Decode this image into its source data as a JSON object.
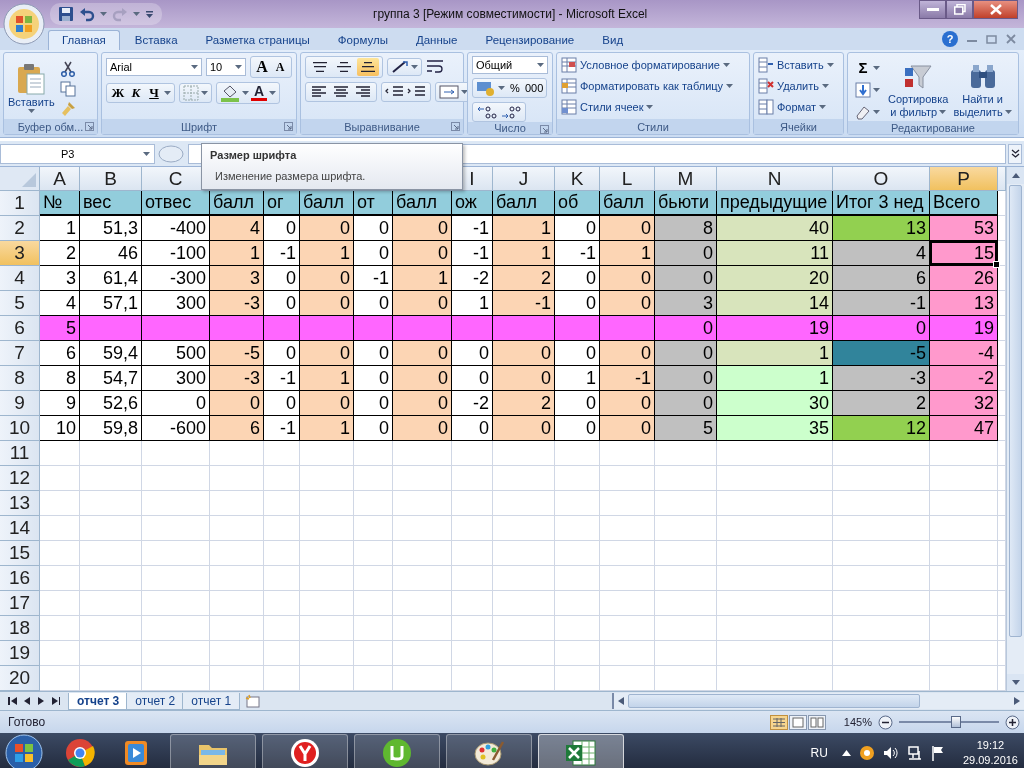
{
  "window": {
    "title": "группа 3  [Режим совместимости] - Microsoft Excel"
  },
  "ribbon_tabs": [
    {
      "label": "Главная",
      "selected": true
    },
    {
      "label": "Вставка",
      "selected": false
    },
    {
      "label": "Разметка страницы",
      "selected": false
    },
    {
      "label": "Формулы",
      "selected": false
    },
    {
      "label": "Данные",
      "selected": false
    },
    {
      "label": "Рецензирование",
      "selected": false
    },
    {
      "label": "Вид",
      "selected": false
    }
  ],
  "help": "?",
  "clipboard": {
    "label": "Буфер обм...",
    "paste": "Вставить"
  },
  "font": {
    "label": "Шрифт",
    "font_name": "Arial",
    "font_size": "10",
    "grow": "A",
    "shrink": "A",
    "bold": "Ж",
    "italic": "К",
    "underline": "Ч",
    "color_button": "A"
  },
  "alignment": {
    "label": "Выравнивание",
    "vertical": [
      {
        "selected": false
      },
      {
        "selected": false
      },
      {
        "selected": true
      }
    ]
  },
  "number": {
    "label": "Число",
    "format": "Общий",
    "percent": "%",
    "thousands": "000"
  },
  "styles": {
    "label": "Стили",
    "items": [
      "Условное форматирование",
      "Форматировать как таблицу",
      "Стили ячеек"
    ]
  },
  "cells": {
    "label": "Ячейки",
    "items": [
      "Вставить",
      "Удалить",
      "Формат"
    ]
  },
  "editing": {
    "label": "Редактирование",
    "sum": "Σ",
    "sort": [
      "Сортировка",
      "и фильтр"
    ],
    "find": [
      "Найти и",
      "выделить"
    ]
  },
  "formula_bar": {
    "name_box": "P3"
  },
  "tooltip": {
    "title": "Размер шрифта",
    "text": "Изменение размера шрифта."
  },
  "column_headers": [
    {
      "letter": "A",
      "selected": false
    },
    {
      "letter": "B",
      "selected": false
    },
    {
      "letter": "C",
      "selected": false
    },
    {
      "letter": "I",
      "selected": false
    },
    {
      "letter": "J",
      "selected": false
    },
    {
      "letter": "K",
      "selected": false
    },
    {
      "letter": "L",
      "selected": false
    },
    {
      "letter": "M",
      "selected": false
    },
    {
      "letter": "N",
      "selected": false
    },
    {
      "letter": "O",
      "selected": false
    },
    {
      "letter": "P",
      "selected": true
    }
  ],
  "rows": [
    {
      "header": "1",
      "selected": false,
      "cells": [
        {
          "value": "№",
          "color": "#92cddc",
          "selected": false
        },
        {
          "value": "вес",
          "color": "#92cddc",
          "selected": false
        },
        {
          "value": "отвес",
          "color": "#92cddc",
          "selected": false
        },
        {
          "value": "балл",
          "color": "#92cddc",
          "selected": false
        },
        {
          "value": "ог",
          "color": "#92cddc",
          "selected": false
        },
        {
          "value": "балл",
          "color": "#92cddc",
          "selected": false
        },
        {
          "value": "от",
          "color": "#92cddc",
          "selected": false
        },
        {
          "value": "балл",
          "color": "#92cddc",
          "selected": false
        },
        {
          "value": "ож",
          "color": "#92cddc",
          "selected": false
        },
        {
          "value": "балл",
          "color": "#92cddc",
          "selected": false
        },
        {
          "value": "об",
          "color": "#92cddc",
          "selected": false
        },
        {
          "value": "балл",
          "color": "#92cddc",
          "selected": false
        },
        {
          "value": "бьюти",
          "color": "#92cddc",
          "selected": false
        },
        {
          "value": "предыдущие",
          "color": "#92cddc",
          "selected": false
        },
        {
          "value": "Итог 3 нед",
          "color": "#92cddc",
          "selected": false
        },
        {
          "value": "Всего",
          "color": "#92cddc",
          "selected": false
        }
      ]
    },
    {
      "header": "2",
      "selected": false,
      "cells": [
        {
          "value": "1",
          "color": "#ffffff",
          "selected": false
        },
        {
          "value": "51,3",
          "color": "#ffffff",
          "selected": false
        },
        {
          "value": "-400",
          "color": "#ffffff",
          "selected": false
        },
        {
          "value": "4",
          "color": "#fcd5b4",
          "selected": false
        },
        {
          "value": "0",
          "color": "#ffffff",
          "selected": false
        },
        {
          "value": "0",
          "color": "#fcd5b4",
          "selected": false
        },
        {
          "value": "0",
          "color": "#ffffff",
          "selected": false
        },
        {
          "value": "0",
          "color": "#fcd5b4",
          "selected": false
        },
        {
          "value": "-1",
          "color": "#ffffff",
          "selected": false
        },
        {
          "value": "1",
          "color": "#fcd5b4",
          "selected": false
        },
        {
          "value": "0",
          "color": "#ffffff",
          "selected": false
        },
        {
          "value": "0",
          "color": "#fcd5b4",
          "selected": false
        },
        {
          "value": "8",
          "color": "#c0c0c0",
          "selected": false
        },
        {
          "value": "40",
          "color": "#d8e4bc",
          "selected": false
        },
        {
          "value": "13",
          "color": "#92d050",
          "selected": false
        },
        {
          "value": "53",
          "color": "#ff99cc",
          "selected": false
        }
      ]
    },
    {
      "header": "3",
      "selected": true,
      "cells": [
        {
          "value": "2",
          "color": "#ffffff",
          "selected": false
        },
        {
          "value": "46",
          "color": "#ffffff",
          "selected": false
        },
        {
          "value": "-100",
          "color": "#ffffff",
          "selected": false
        },
        {
          "value": "1",
          "color": "#fcd5b4",
          "selected": false
        },
        {
          "value": "-1",
          "color": "#ffffff",
          "selected": false
        },
        {
          "value": "1",
          "color": "#fcd5b4",
          "selected": false
        },
        {
          "value": "0",
          "color": "#ffffff",
          "selected": false
        },
        {
          "value": "0",
          "color": "#fcd5b4",
          "selected": false
        },
        {
          "value": "-1",
          "color": "#ffffff",
          "selected": false
        },
        {
          "value": "1",
          "color": "#fcd5b4",
          "selected": false
        },
        {
          "value": "-1",
          "color": "#ffffff",
          "selected": false
        },
        {
          "value": "1",
          "color": "#fcd5b4",
          "selected": false
        },
        {
          "value": "0",
          "color": "#c0c0c0",
          "selected": false
        },
        {
          "value": "11",
          "color": "#d8e4bc",
          "selected": false
        },
        {
          "value": "4",
          "color": "#c0c0c0",
          "selected": false
        },
        {
          "value": "15",
          "color": "#ff99cc",
          "selected": true
        }
      ]
    },
    {
      "header": "4",
      "selected": false,
      "cells": [
        {
          "value": "3",
          "color": "#ffffff",
          "selected": false
        },
        {
          "value": "61,4",
          "color": "#ffffff",
          "selected": false
        },
        {
          "value": "-300",
          "color": "#ffffff",
          "selected": false
        },
        {
          "value": "3",
          "color": "#fcd5b4",
          "selected": false
        },
        {
          "value": "0",
          "color": "#ffffff",
          "selected": false
        },
        {
          "value": "0",
          "color": "#fcd5b4",
          "selected": false
        },
        {
          "value": "-1",
          "color": "#ffffff",
          "selected": false
        },
        {
          "value": "1",
          "color": "#fcd5b4",
          "selected": false
        },
        {
          "value": "-2",
          "color": "#ffffff",
          "selected": false
        },
        {
          "value": "2",
          "color": "#fcd5b4",
          "selected": false
        },
        {
          "value": "0",
          "color": "#ffffff",
          "selected": false
        },
        {
          "value": "0",
          "color": "#fcd5b4",
          "selected": false
        },
        {
          "value": "0",
          "color": "#c0c0c0",
          "selected": false
        },
        {
          "value": "20",
          "color": "#d8e4bc",
          "selected": false
        },
        {
          "value": "6",
          "color": "#c0c0c0",
          "selected": false
        },
        {
          "value": "26",
          "color": "#ff99cc",
          "selected": false
        }
      ]
    },
    {
      "header": "5",
      "selected": false,
      "cells": [
        {
          "value": "4",
          "color": "#ffffff",
          "selected": false
        },
        {
          "value": "57,1",
          "color": "#ffffff",
          "selected": false
        },
        {
          "value": "300",
          "color": "#ffffff",
          "selected": false
        },
        {
          "value": "-3",
          "color": "#fcd5b4",
          "selected": false
        },
        {
          "value": "0",
          "color": "#ffffff",
          "selected": false
        },
        {
          "value": "0",
          "color": "#fcd5b4",
          "selected": false
        },
        {
          "value": "0",
          "color": "#ffffff",
          "selected": false
        },
        {
          "value": "0",
          "color": "#fcd5b4",
          "selected": false
        },
        {
          "value": "1",
          "color": "#ffffff",
          "selected": false
        },
        {
          "value": "-1",
          "color": "#fcd5b4",
          "selected": false
        },
        {
          "value": "0",
          "color": "#ffffff",
          "selected": false
        },
        {
          "value": "0",
          "color": "#fcd5b4",
          "selected": false
        },
        {
          "value": "3",
          "color": "#c0c0c0",
          "selected": false
        },
        {
          "value": "14",
          "color": "#d8e4bc",
          "selected": false
        },
        {
          "value": "-1",
          "color": "#c0c0c0",
          "selected": false
        },
        {
          "value": "13",
          "color": "#ff99cc",
          "selected": false
        }
      ]
    },
    {
      "header": "6",
      "selected": false,
      "cells": [
        {
          "value": "5",
          "color": "#ff66ff",
          "selected": false
        },
        {
          "color": "#ff66ff",
          "selected": false
        },
        {
          "color": "#ff66ff",
          "selected": false
        },
        {
          "color": "#ff66ff",
          "selected": false
        },
        {
          "color": "#ff66ff",
          "selected": false
        },
        {
          "color": "#ff66ff",
          "selected": false
        },
        {
          "color": "#ff66ff",
          "selected": false
        },
        {
          "color": "#ff66ff",
          "selected": false
        },
        {
          "color": "#ff66ff",
          "selected": false
        },
        {
          "color": "#ff66ff",
          "selected": false
        },
        {
          "color": "#ff66ff",
          "selected": false
        },
        {
          "color": "#ff66ff",
          "selected": false
        },
        {
          "value": "0",
          "color": "#ff66ff",
          "selected": false
        },
        {
          "value": "19",
          "color": "#ff66ff",
          "selected": false
        },
        {
          "value": "0",
          "color": "#ff66ff",
          "selected": false
        },
        {
          "value": "19",
          "color": "#ff66ff",
          "selected": false
        }
      ]
    },
    {
      "header": "7",
      "selected": false,
      "cells": [
        {
          "value": "6",
          "color": "#ffffff",
          "selected": false
        },
        {
          "value": "59,4",
          "color": "#ffffff",
          "selected": false
        },
        {
          "value": "500",
          "color": "#ffffff",
          "selected": false
        },
        {
          "value": "-5",
          "color": "#fcd5b4",
          "selected": false
        },
        {
          "value": "0",
          "color": "#ffffff",
          "selected": false
        },
        {
          "value": "0",
          "color": "#fcd5b4",
          "selected": false
        },
        {
          "value": "0",
          "color": "#ffffff",
          "selected": false
        },
        {
          "value": "0",
          "color": "#fcd5b4",
          "selected": false
        },
        {
          "value": "0",
          "color": "#ffffff",
          "selected": false
        },
        {
          "value": "0",
          "color": "#fcd5b4",
          "selected": false
        },
        {
          "value": "0",
          "color": "#ffffff",
          "selected": false
        },
        {
          "value": "0",
          "color": "#fcd5b4",
          "selected": false
        },
        {
          "value": "0",
          "color": "#c0c0c0",
          "selected": false
        },
        {
          "value": "1",
          "color": "#d8e4bc",
          "selected": false
        },
        {
          "value": "-5",
          "color": "#31849b",
          "selected": false
        },
        {
          "value": "-4",
          "color": "#ff99cc",
          "selected": false
        }
      ]
    },
    {
      "header": "8",
      "selected": false,
      "cells": [
        {
          "value": "8",
          "color": "#ffffff",
          "selected": false
        },
        {
          "value": "54,7",
          "color": "#ffffff",
          "selected": false
        },
        {
          "value": "300",
          "color": "#ffffff",
          "selected": false
        },
        {
          "value": "-3",
          "color": "#fcd5b4",
          "selected": false
        },
        {
          "value": "-1",
          "color": "#ffffff",
          "selected": false
        },
        {
          "value": "1",
          "color": "#fcd5b4",
          "selected": false
        },
        {
          "value": "0",
          "color": "#ffffff",
          "selected": false
        },
        {
          "value": "0",
          "color": "#fcd5b4",
          "selected": false
        },
        {
          "value": "0",
          "color": "#ffffff",
          "selected": false
        },
        {
          "value": "0",
          "color": "#fcd5b4",
          "selected": false
        },
        {
          "value": "1",
          "color": "#ffffff",
          "selected": false
        },
        {
          "value": "-1",
          "color": "#fcd5b4",
          "selected": false
        },
        {
          "value": "0",
          "color": "#c0c0c0",
          "selected": false
        },
        {
          "value": "1",
          "color": "#ccffcc",
          "selected": false
        },
        {
          "value": "-3",
          "color": "#c0c0c0",
          "selected": false
        },
        {
          "value": "-2",
          "color": "#ff99cc",
          "selected": false
        }
      ]
    },
    {
      "header": "9",
      "selected": false,
      "cells": [
        {
          "value": "9",
          "color": "#ffffff",
          "selected": false
        },
        {
          "value": "52,6",
          "color": "#ffffff",
          "selected": false
        },
        {
          "value": "0",
          "color": "#ffffff",
          "selected": false
        },
        {
          "value": "0",
          "color": "#fcd5b4",
          "selected": false
        },
        {
          "value": "0",
          "color": "#ffffff",
          "selected": false
        },
        {
          "value": "0",
          "color": "#fcd5b4",
          "selected": false
        },
        {
          "value": "0",
          "color": "#ffffff",
          "selected": false
        },
        {
          "value": "0",
          "color": "#fcd5b4",
          "selected": false
        },
        {
          "value": "-2",
          "color": "#ffffff",
          "selected": false
        },
        {
          "value": "2",
          "color": "#fcd5b4",
          "selected": false
        },
        {
          "value": "0",
          "color": "#ffffff",
          "selected": false
        },
        {
          "value": "0",
          "color": "#fcd5b4",
          "selected": false
        },
        {
          "value": "0",
          "color": "#c0c0c0",
          "selected": false
        },
        {
          "value": "30",
          "color": "#ccffcc",
          "selected": false
        },
        {
          "value": "2",
          "color": "#c0c0c0",
          "selected": false
        },
        {
          "value": "32",
          "color": "#ff99cc",
          "selected": false
        }
      ]
    },
    {
      "header": "10",
      "selected": false,
      "cells": [
        {
          "value": "10",
          "color": "#ffffff",
          "selected": false
        },
        {
          "value": "59,8",
          "color": "#ffffff",
          "selected": false
        },
        {
          "value": "-600",
          "color": "#ffffff",
          "selected": false
        },
        {
          "value": "6",
          "color": "#fcd5b4",
          "selected": false
        },
        {
          "value": "-1",
          "color": "#ffffff",
          "selected": false
        },
        {
          "value": "1",
          "color": "#fcd5b4",
          "selected": false
        },
        {
          "value": "0",
          "color": "#ffffff",
          "selected": false
        },
        {
          "value": "0",
          "color": "#fcd5b4",
          "selected": false
        },
        {
          "value": "0",
          "color": "#ffffff",
          "selected": false
        },
        {
          "value": "0",
          "color": "#fcd5b4",
          "selected": false
        },
        {
          "value": "0",
          "color": "#ffffff",
          "selected": false
        },
        {
          "value": "0",
          "color": "#fcd5b4",
          "selected": false
        },
        {
          "value": "5",
          "color": "#c0c0c0",
          "selected": false
        },
        {
          "value": "35",
          "color": "#ccffcc",
          "selected": false
        },
        {
          "value": "12",
          "color": "#92d050",
          "selected": false
        },
        {
          "value": "47",
          "color": "#ff99cc",
          "selected": false
        }
      ]
    },
    {
      "header": "11",
      "selected": false
    },
    {
      "header": "12",
      "selected": false
    },
    {
      "header": "13",
      "selected": false
    },
    {
      "header": "14",
      "selected": false
    },
    {
      "header": "15",
      "selected": false
    },
    {
      "header": "16",
      "selected": false
    },
    {
      "header": "17",
      "selected": false
    },
    {
      "header": "18",
      "selected": false
    },
    {
      "header": "19",
      "selected": false
    },
    {
      "header": "20",
      "selected": false
    }
  ],
  "sheet_tabs": [
    {
      "label": "отчет 3",
      "selected": true
    },
    {
      "label": "отчет 2",
      "selected": false
    },
    {
      "label": "отчет 1",
      "selected": false
    }
  ],
  "status_bar": {
    "text": "Готово",
    "zoom": "145%",
    "zoom_slider": {
      "level": 0.57
    }
  },
  "taskbar": {
    "apps": [
      {
        "kind": "browser",
        "running": false,
        "selected": false
      },
      {
        "kind": "media",
        "running": false,
        "selected": false
      },
      {
        "kind": "folder",
        "running": true,
        "selected": false
      },
      {
        "kind": "yandex",
        "running": true,
        "selected": false
      },
      {
        "kind": "torrent",
        "running": true,
        "selected": false
      },
      {
        "kind": "paint",
        "running": true,
        "selected": false
      },
      {
        "kind": "excel",
        "running": true,
        "selected": true
      }
    ],
    "language": "RU",
    "time": "19:12",
    "date": "29.09.2016"
  }
}
